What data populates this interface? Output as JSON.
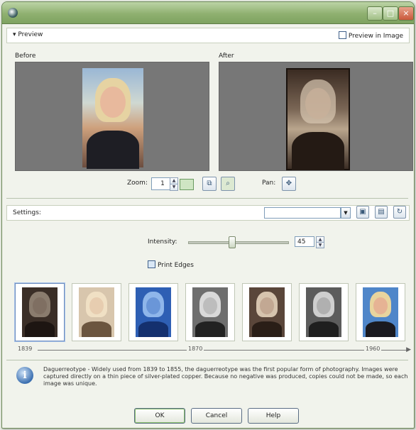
{
  "window": {
    "title": "",
    "minimize_label": "–",
    "maximize_label": "□",
    "close_label": "×"
  },
  "preview": {
    "toggle_label": "▾ Preview",
    "preview_in_image_label": "Preview in Image",
    "before_label": "Before",
    "after_label": "After"
  },
  "zoom": {
    "label": "Zoom:",
    "value": "1",
    "pan_label": "Pan:"
  },
  "settings": {
    "label": "Settings:",
    "preset_value": ""
  },
  "intensity": {
    "label": "Intensity:",
    "value": "45",
    "level": 0.45
  },
  "print_edges": {
    "label": "Print Edges",
    "checked": true
  },
  "thumbnails": [
    {
      "style": "daguerreotype",
      "selected": true
    },
    {
      "style": "sepia-light",
      "selected": false
    },
    {
      "style": "cyanotype",
      "selected": false
    },
    {
      "style": "grayscale-vintage",
      "selected": false
    },
    {
      "style": "warm-tone",
      "selected": false
    },
    {
      "style": "gray-tone",
      "selected": false
    },
    {
      "style": "color",
      "selected": false
    }
  ],
  "timeline": {
    "start": "1839",
    "middle": "1870",
    "end": "1960"
  },
  "info": {
    "text": "Daguerreotype - Widely used from 1839 to 1855, the daguerreotype was the first popular form of photography. Images were captured directly on a thin piece of silver-plated copper. Because no negative was produced, copies could not be made, so each image was unique."
  },
  "buttons": {
    "ok": "OK",
    "cancel": "Cancel",
    "help": "Help"
  },
  "colors": {
    "title_bar": "#8fb070",
    "window_bg": "#f1f3ec",
    "preview_bg": "#777777"
  }
}
